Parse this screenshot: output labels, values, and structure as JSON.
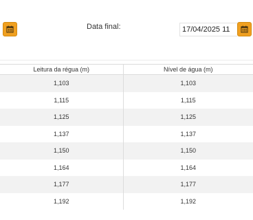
{
  "filters": {
    "end_date_label": "Data final:",
    "end_date_value": "17/04/2025 11",
    "calendar_icon": "calendar-icon",
    "accent_color": "#f0a020"
  },
  "table": {
    "headers": [
      "Leitura da régua (m)",
      "Nível de água (m)"
    ],
    "rows": [
      [
        "1,103",
        "1,103"
      ],
      [
        "1,115",
        "1,115"
      ],
      [
        "1,125",
        "1,125"
      ],
      [
        "1,137",
        "1,137"
      ],
      [
        "1,150",
        "1,150"
      ],
      [
        "1,164",
        "1,164"
      ],
      [
        "1,177",
        "1,177"
      ],
      [
        "1,192",
        "1,192"
      ]
    ]
  }
}
